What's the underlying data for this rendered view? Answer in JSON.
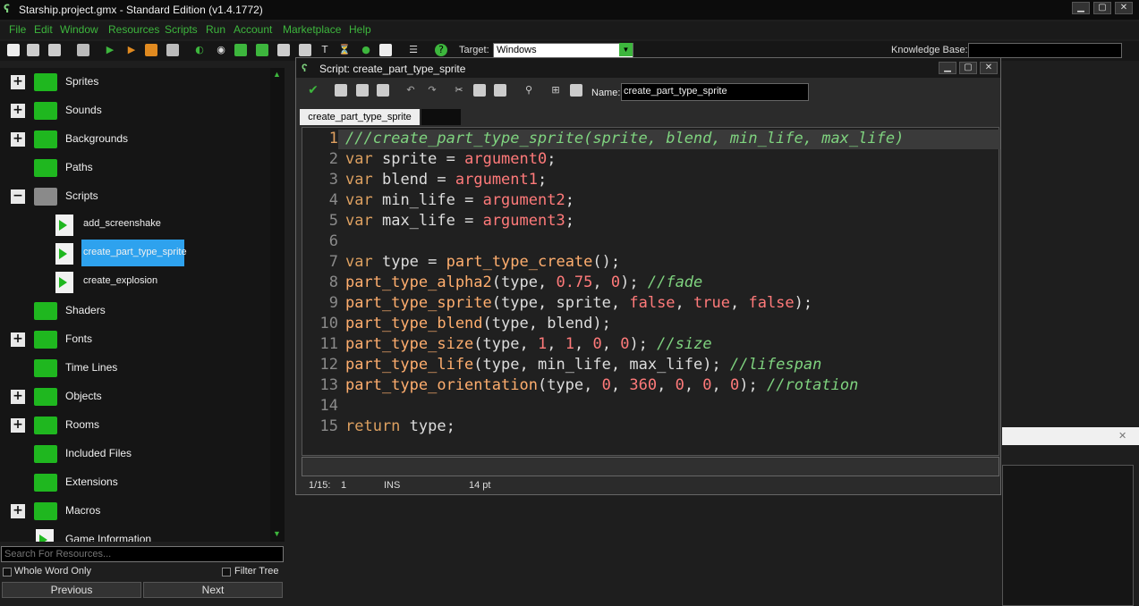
{
  "window": {
    "title": "Starship.project.gmx  -  Standard Edition (v1.4.1772)",
    "min": "▁",
    "max": "▢",
    "close": "✕"
  },
  "menu": [
    "File",
    "Edit",
    "Window",
    "Resources",
    "Scripts",
    "Run",
    "Account",
    "Marketplace",
    "Help"
  ],
  "toolbar": {
    "target_label": "Target:",
    "target_value": "Windows",
    "kb_label": "Knowledge Base:"
  },
  "tree": {
    "items": [
      {
        "label": "Sprites",
        "expand": "+"
      },
      {
        "label": "Sounds",
        "expand": "+"
      },
      {
        "label": "Backgrounds",
        "expand": "+"
      },
      {
        "label": "Paths",
        "expand": ""
      },
      {
        "label": "Scripts",
        "expand": "−"
      },
      {
        "label": "add_screenshake",
        "type": "script"
      },
      {
        "label": "create_part_type_sprite",
        "type": "script",
        "selected": true
      },
      {
        "label": "create_explosion",
        "type": "script"
      },
      {
        "label": "Shaders",
        "expand": ""
      },
      {
        "label": "Fonts",
        "expand": "+"
      },
      {
        "label": "Time Lines",
        "expand": ""
      },
      {
        "label": "Objects",
        "expand": "+"
      },
      {
        "label": "Rooms",
        "expand": "+"
      },
      {
        "label": "Included Files",
        "expand": ""
      },
      {
        "label": "Extensions",
        "expand": ""
      },
      {
        "label": "Macros",
        "expand": "+"
      },
      {
        "label": "Game Information",
        "expand": ""
      }
    ],
    "search_placeholder": "Search For Resources...",
    "whole_word": "Whole Word Only",
    "filter_tree": "Filter Tree",
    "prev": "Previous",
    "next": "Next"
  },
  "editor": {
    "title": "Script: create_part_type_sprite",
    "name_label": "Name:",
    "name_value": "create_part_type_sprite",
    "tab": "create_part_type_sprite",
    "status": {
      "pos": "1/15:",
      "col": "1",
      "mode": "INS",
      "size": "14 pt"
    },
    "lines": [
      "///create_part_type_sprite(sprite, blend, min_life, max_life)",
      "var sprite = argument0;",
      "var blend = argument1;",
      "var min_life = argument2;",
      "var max_life = argument3;",
      "",
      "var type = part_type_create();",
      "part_type_alpha2(type, 0.75, 0); //fade",
      "part_type_sprite(type, sprite, false, true, false);",
      "part_type_blend(type, blend);",
      "part_type_size(type, 1, 1, 0, 0); //size",
      "part_type_life(type, min_life, max_life); //lifespan",
      "part_type_orientation(type, 0, 360, 0, 0, 0); //rotation",
      "",
      "return type;"
    ]
  },
  "colors": {
    "accent": "#3db63d",
    "selection": "#2ea2ee",
    "folder": "#1fb71f"
  }
}
